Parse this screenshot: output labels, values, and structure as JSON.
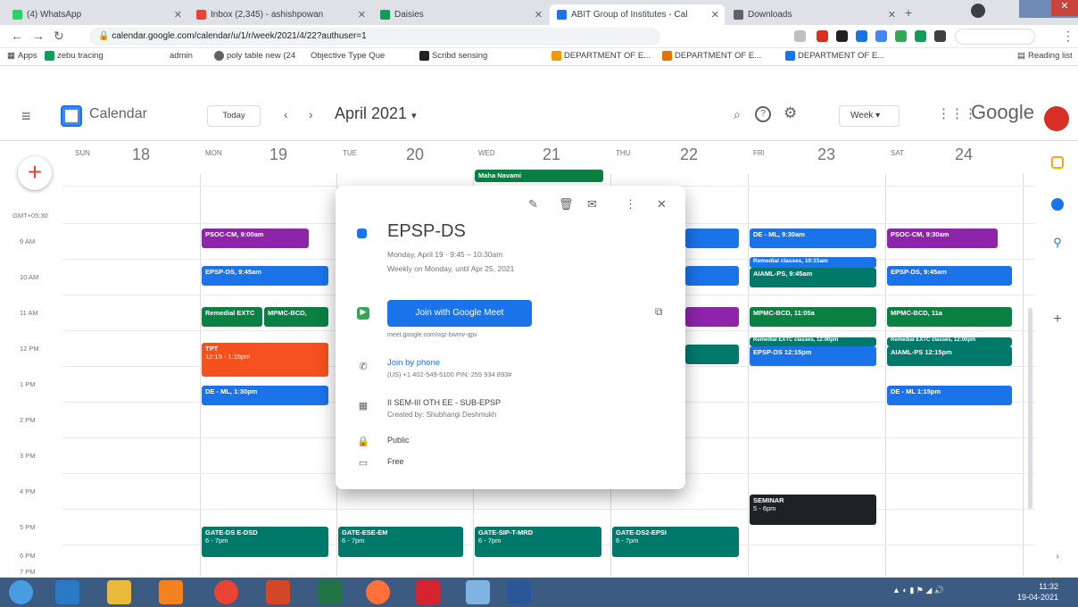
{
  "browser": {
    "tabs": [
      {
        "label": "(4) WhatsApp",
        "color": "#25d366"
      },
      {
        "label": "Inbox (2,345) - ashishpowan",
        "color": "#ea4335"
      },
      {
        "label": "Daisies",
        "color": "#0f9d58"
      },
      {
        "label": "ABIT Group of Institutes - Cal",
        "color": "#1a73e8"
      },
      {
        "label": "Downloads",
        "color": "#5f6368"
      }
    ],
    "url": "calendar.google.com/calendar/u/1/r/week/2021/4/22?authuser=1",
    "bookmarks": [
      "Apps",
      "zebu tracing",
      "admin",
      "poly table new (24",
      "Objective Type Que",
      "Scribd sensing",
      "DEPARTMENT OF E...",
      "DEPARTMENT OF E...",
      "DEPARTMENT OF E...",
      "Reading list"
    ]
  },
  "header": {
    "app_name": "Calendar",
    "today_label": "Today",
    "month": "April 2021",
    "view": "Week",
    "brand": "Google"
  },
  "days": [
    {
      "name": "SUN",
      "num": "18"
    },
    {
      "name": "MON",
      "num": "19"
    },
    {
      "name": "TUE",
      "num": "20"
    },
    {
      "name": "WED",
      "num": "21"
    },
    {
      "name": "THU",
      "num": "22"
    },
    {
      "name": "FRI",
      "num": "23"
    },
    {
      "name": "SAT",
      "num": "24"
    }
  ],
  "times": [
    "GMT+05:30",
    "9 AM",
    "10 AM",
    "11 AM",
    "12 PM",
    "1 PM",
    "2 PM",
    "3 PM",
    "4 PM",
    "5 PM",
    "6 PM",
    "7 PM"
  ],
  "allday": {
    "label": "Maha Navami"
  },
  "events": [
    {
      "id": "mon1",
      "title": "PSOC-CM, 9:00am",
      "sub": "",
      "color": "#8e24aa"
    },
    {
      "id": "mon2",
      "title": "EPSP-DS, 9:45am",
      "sub": "",
      "color": "#1a73e8"
    },
    {
      "id": "mon3a",
      "title": "Remedial EXTC",
      "sub": "",
      "color": "#0b8043"
    },
    {
      "id": "mon3b",
      "title": "MPMC-BCD,",
      "sub": "",
      "color": "#0b8043"
    },
    {
      "id": "mon4",
      "title": "TPT",
      "sub": "12:15 - 1:15pm",
      "color": "#f4511e"
    },
    {
      "id": "mon5",
      "title": "DE - ML, 1:30pm",
      "sub": "",
      "color": "#1a73e8"
    },
    {
      "id": "mon6",
      "title": "GATE-DS E-DSD",
      "sub": "6 - 7pm",
      "color": "#00796b"
    },
    {
      "id": "tue1",
      "title": "GATE-ESE-EM",
      "sub": "6 - 7pm",
      "color": "#00796b"
    },
    {
      "id": "wed1",
      "title": "GATE-SIP-T-MRD",
      "sub": "6 - 7pm",
      "color": "#00796b"
    },
    {
      "id": "thu1",
      "title": "GATE-DS2-EPSI",
      "sub": "6 - 7pm",
      "color": "#00796b"
    },
    {
      "id": "fri1",
      "title": "DE - ML, 9:30am",
      "sub": "",
      "color": "#1a73e8"
    },
    {
      "id": "fri2",
      "title": "Remedial classes, 10:15am",
      "sub": "",
      "color": "#1a73e8"
    },
    {
      "id": "fri3",
      "title": "AIAML-PS, 9:45am",
      "sub": "",
      "color": "#00796b"
    },
    {
      "id": "fri4",
      "title": "MPMC-BCD, 11:05a",
      "sub": "",
      "color": "#0b8043"
    },
    {
      "id": "fri5",
      "title": "Remedial EXTC classes, 12:00pm",
      "sub": "",
      "color": "#00796b"
    },
    {
      "id": "fri6",
      "title": "EPSP-DS 12:15pm",
      "sub": "",
      "color": "#1a73e8"
    },
    {
      "id": "fri7",
      "title": "SEMINAR",
      "sub": "5 - 6pm",
      "color": "#202124"
    },
    {
      "id": "sat1",
      "title": "PSOC-CM, 9:30am",
      "sub": "",
      "color": "#8e24aa"
    },
    {
      "id": "sat2",
      "title": "EPSP-DS, 9:45am",
      "sub": "",
      "color": "#1a73e8"
    },
    {
      "id": "sat3",
      "title": "MPMC-BCD, 11a",
      "sub": "",
      "color": "#0b8043"
    },
    {
      "id": "sat4",
      "title": "Remedial EXTC classes, 12:00pm",
      "sub": "",
      "color": "#00796b"
    },
    {
      "id": "sat5",
      "title": "AIAML-PS 12:15pm",
      "sub": "",
      "color": "#00796b"
    },
    {
      "id": "sat6",
      "title": "DE - ML 1:15pm",
      "sub": "",
      "color": "#1a73e8"
    }
  ],
  "popup": {
    "title": "EPSP-DS",
    "when": "Monday, April 19  ·  9:45 – 10:30am",
    "repeat": "Weekly on Monday, until Apr 25, 2021",
    "meet_label": "Join with Google Meet",
    "meet_link": "meet.google.com/vqz-bwmv-qpv",
    "phone_label": "Join by phone",
    "phone_detail": "(US) +1 402-549-5100 PIN: 255 934 893#",
    "calendar_name": "II SEM-III OTH EE - SUB-EPSP",
    "created_by": "Created by: Shubhangi Deshmukh",
    "visibility": "Public",
    "availability": "Free",
    "accent": "#1a73e8"
  },
  "taskbar": {
    "time": "11:32",
    "date": "19-04-2021"
  }
}
